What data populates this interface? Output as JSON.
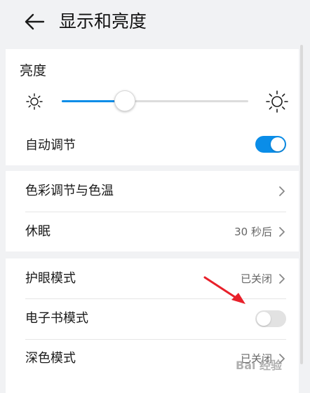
{
  "header": {
    "title": "显示和亮度"
  },
  "brightness": {
    "label": "亮度",
    "level_percent": 34
  },
  "auto_adjust": {
    "label": "自动调节",
    "enabled": true
  },
  "color_temp": {
    "label": "色彩调节与色温"
  },
  "sleep": {
    "label": "休眠",
    "value": "30 秒后"
  },
  "eye_comfort": {
    "label": "护眼模式",
    "value": "已关闭"
  },
  "ebook_mode": {
    "label": "电子书模式",
    "enabled": false
  },
  "dark_mode": {
    "label": "深色模式",
    "value": "已关闭"
  },
  "watermark": "Bai 经验",
  "colors": {
    "accent": "#0a8de8",
    "annotation_arrow": "#e8202a",
    "background": "#f1f2f4"
  },
  "icons": [
    "back-arrow-icon",
    "sun-icon",
    "chevron-right-icon"
  ]
}
